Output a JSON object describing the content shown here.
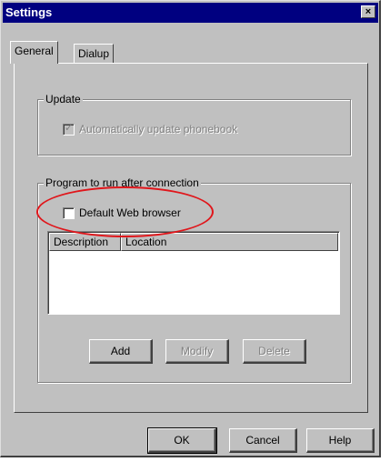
{
  "window": {
    "title": "Settings",
    "close_glyph": "×"
  },
  "tabs": [
    {
      "label": "General",
      "active": true
    },
    {
      "label": "Dialup",
      "active": false
    }
  ],
  "update_group": {
    "label": "Update",
    "checkbox_label": "Automatically update phonebook",
    "checked": true,
    "enabled": false
  },
  "program_group": {
    "label": "Program to run after connection",
    "checkbox_label": "Default Web browser",
    "checked": false,
    "columns": [
      "Description",
      "Location"
    ],
    "rows": [],
    "buttons": [
      {
        "label": "Add",
        "enabled": true
      },
      {
        "label": "Modify",
        "enabled": false
      },
      {
        "label": "Delete",
        "enabled": false
      }
    ]
  },
  "footer_buttons": [
    {
      "label": "OK"
    },
    {
      "label": "Cancel"
    },
    {
      "label": "Help"
    }
  ],
  "annotation": {
    "shape": "ellipse",
    "color": "#e0161b"
  }
}
